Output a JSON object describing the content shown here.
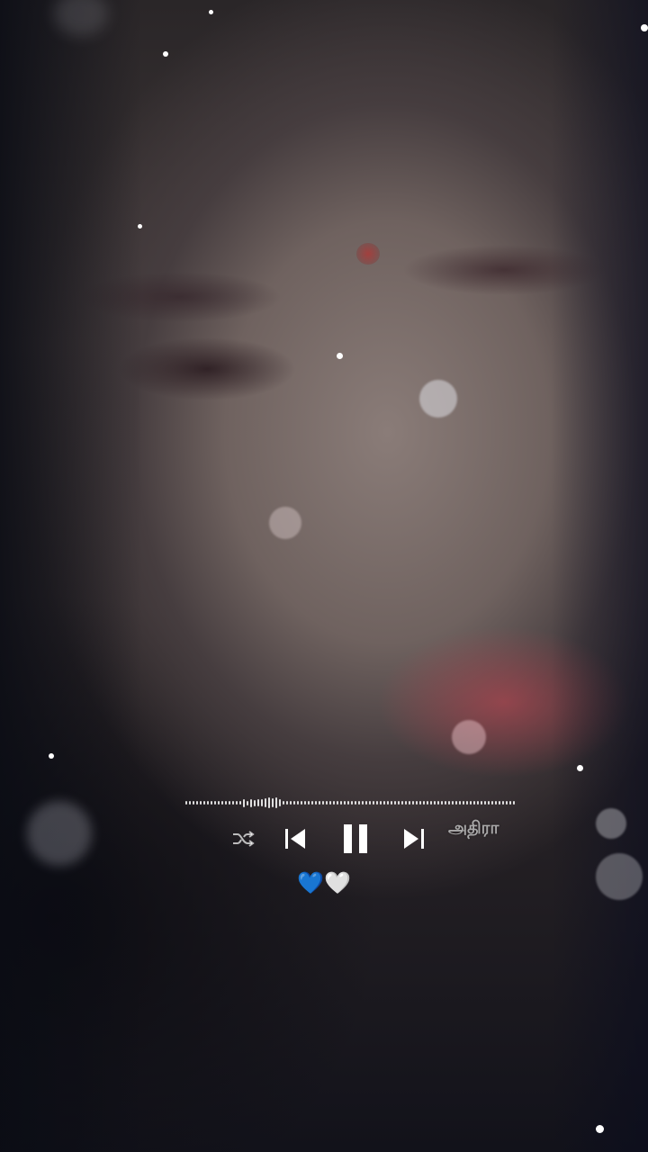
{
  "player": {
    "artist_text": "அதிரா",
    "caption": "💙🤍",
    "state": "playing",
    "icons": {
      "shuffle": "shuffle-icon",
      "previous": "skip-previous-icon",
      "pause": "pause-icon",
      "next": "skip-next-icon"
    },
    "colors": {
      "icon": "#ffffff",
      "artist_text": "#d7d7d7"
    }
  }
}
